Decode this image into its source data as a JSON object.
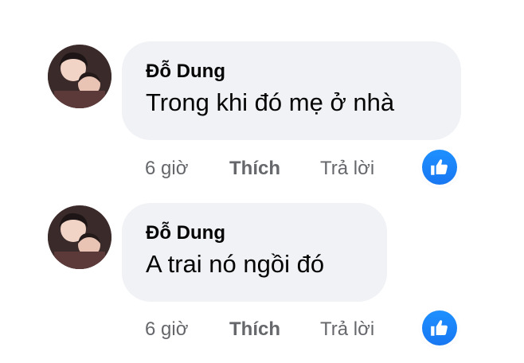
{
  "comments": [
    {
      "author": "Đỗ Dung",
      "text": "Trong khi đó mẹ ở nhà",
      "time": "6 giờ",
      "like_label": "Thích",
      "reply_label": "Trả lời",
      "reaction_icon": "thumbs-up-icon"
    },
    {
      "author": "Đỗ Dung",
      "text": "A trai nó ngồi đó",
      "time": "6 giờ",
      "like_label": "Thích",
      "reply_label": "Trả lời",
      "reaction_icon": "thumbs-up-icon"
    }
  ],
  "colors": {
    "bubble_bg": "#f0f2f5",
    "text": "#050505",
    "secondary_text": "#65676b",
    "like_blue": "#1877f2"
  }
}
